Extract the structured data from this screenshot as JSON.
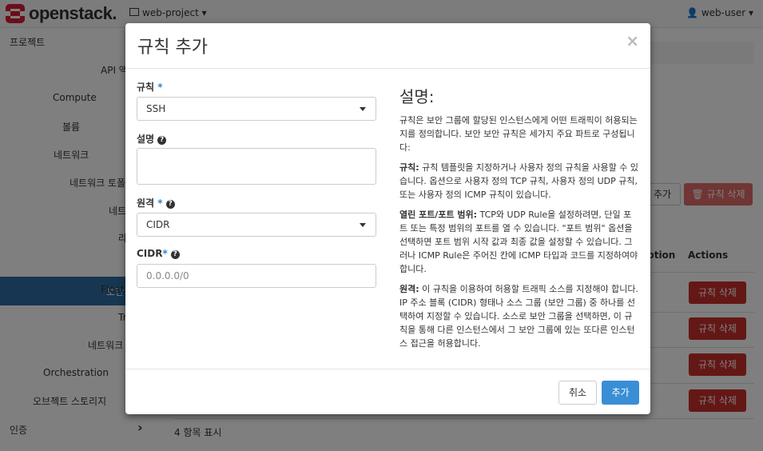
{
  "brand": {
    "name": "openstack."
  },
  "topbar": {
    "project": "web-project ▾",
    "user": "web-user ▾"
  },
  "sidebar": {
    "items": [
      {
        "label": "프로젝트"
      },
      {
        "label": "API 액"
      },
      {
        "label": "Compute"
      },
      {
        "label": "볼륨"
      },
      {
        "label": "네트워크"
      },
      {
        "label": "네트워크 토폴"
      },
      {
        "label": "네트"
      },
      {
        "label": "라"
      },
      {
        "label": "보안"
      },
      {
        "label": "Floati"
      },
      {
        "label": "Tr"
      },
      {
        "label": "네트워크"
      },
      {
        "label": "Orchestration"
      },
      {
        "label": "오브젝트 스토리지"
      },
      {
        "label": "인증"
      }
    ],
    "chevron": "›"
  },
  "main": {
    "add_button": "추가",
    "delete_rules_button": "규칙 삭제",
    "col_description": "iption",
    "col_actions": "Actions",
    "row_delete": "규칙 삭제",
    "footer": "4 항목 표시"
  },
  "modal": {
    "title": "규칙 추가",
    "close": "×",
    "rule_label": "규칙",
    "rule_value": "SSH",
    "desc_label": "설명",
    "remote_label": "원격",
    "remote_value": "CIDR",
    "cidr_label": "CIDR",
    "cidr_placeholder": "0.0.0.0/0",
    "help_title": "설명:",
    "help_intro": "규칙은 보안 그룹에 할당된 인스턴스에게 어떤 트래픽이 허용되는지를 정의합니다. 보안 보안 규칙은 세가지 주요 파트로 구성됩니다:",
    "help_rule_term": "규칙:",
    "help_rule_text": " 규칙 템플릿을 지정하거나 사용자 정의 규칙을 사용할 수 있습니다. 옵션으로 사용자 정의 TCP 규칙, 사용자 정의 UDP 규칙, 또는 사용자 정의 ICMP 규칙이 있습니다.",
    "help_port_term": "열린 포트/포트 범위:",
    "help_port_text": " TCP와 UDP Rule을 설정하려면, 단일 포트 또는 특정 범위의 포트를 열 수 있습니다. \"포트 범위\" 옵션을 선택하면 포트 범위 시작 값과 최종 값을 설정할 수 있습니다. 그러나 ICMP Rule은 주어진 칸에 ICMP 타입과 코드를 지정하여야 합니다.",
    "help_remote_term": "원격:",
    "help_remote_text": " 이 규칙을 이용하여 허용할 트래픽 소스를 지정해야 합니다. IP 주소 블록 (CIDR) 형태나 소스 그룹 (보안 그룹) 중 하나를 선택하여 지정할 수 있습니다. 소스로 보안 그룹을 선택하면, 이 규칙을 통해 다른 인스턴스에서 그 보안 그룹에 있는 또다른 인스턴스 접근을 허용합니다.",
    "cancel": "취소",
    "submit": "추가"
  },
  "colors": {
    "primary": "#3a8ed6",
    "danger": "#c9302c",
    "active_nav": "#2d6ca2"
  }
}
